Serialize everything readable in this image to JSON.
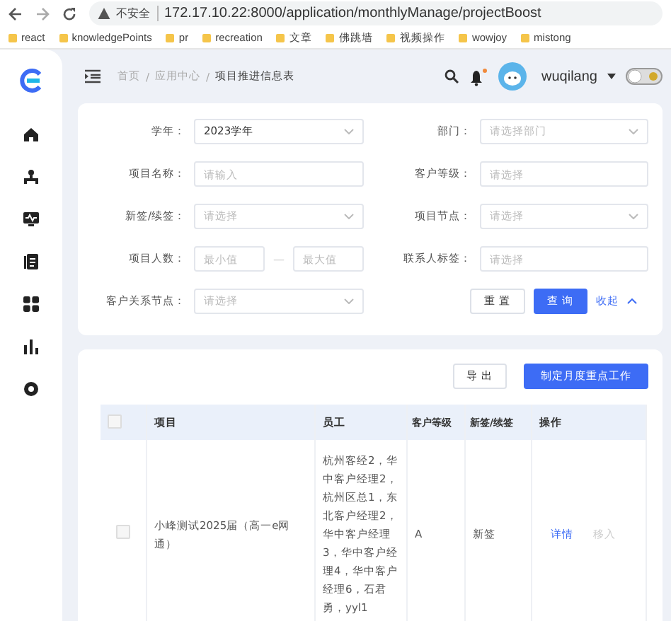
{
  "browser": {
    "security": "不安全",
    "url": "172.17.10.22:8000/application/monthlyManage/projectBoost",
    "bookmarks": [
      "react",
      "knowledgePoints",
      "pr",
      "recreation",
      "文章",
      "佛跳墙",
      "视频操作",
      "wowjoy",
      "mistong"
    ]
  },
  "breadcrumb": [
    "首页",
    "应用中心",
    "项目推进信息表"
  ],
  "breadcrumb_separators": [
    "/",
    "/"
  ],
  "header": {
    "notifications_unread": true,
    "user": "wuqilang",
    "theme_switch_on": false
  },
  "sidebar": {
    "items": [
      {
        "selected": false
      },
      {
        "selected": false
      },
      {
        "selected": false
      },
      {
        "selected": false
      },
      {
        "selected": false
      },
      {
        "selected": false
      },
      {
        "selected": false
      }
    ]
  },
  "filters": [
    {
      "label": "学年：",
      "kind": "select",
      "value": "2023学年"
    },
    {
      "label": "部门：",
      "kind": "select",
      "placeholder": "请选择部门"
    },
    {
      "label": "项目名称：",
      "kind": "input",
      "placeholder": "请输入"
    },
    {
      "label": "客户等级：",
      "kind": "input",
      "placeholder": "请选择"
    },
    {
      "label": "新签/续签：",
      "kind": "select",
      "placeholder": "请选择"
    },
    {
      "label": "项目节点：",
      "kind": "select",
      "placeholder": "请选择"
    },
    {
      "label": "项目人数：",
      "kind": "range",
      "placeholder_min": "最小值",
      "separator": "—",
      "placeholder_max": "最大值"
    },
    {
      "label": "联系人标签：",
      "kind": "input",
      "placeholder": "请选择"
    },
    {
      "label": "客户关系节点：",
      "kind": "select",
      "placeholder": "请选择"
    }
  ],
  "filter_actions": {
    "reset": "重 置",
    "search": "查 询",
    "collapse": "收起"
  },
  "toolbar": {
    "export": "导 出",
    "primary": "制定月度重点工作"
  },
  "table": {
    "all_checked": false,
    "columns": [
      "项目",
      "员工",
      "客户等级",
      "新签/续签",
      "操作"
    ],
    "rows": [
      {
        "checked": false,
        "project": "小峰测试2025届（高一e网通）",
        "staff": "杭州客经2，华中客户经理2，杭州区总1，东北客户经理2，华中客户经理3，华中客户经理4，华中客户经理6，石君勇，yyl1",
        "level": "A",
        "sign": "新签",
        "actions": [
          {
            "label": "详情",
            "disabled": false
          },
          {
            "label": "移入",
            "disabled": true
          }
        ]
      }
    ]
  }
}
